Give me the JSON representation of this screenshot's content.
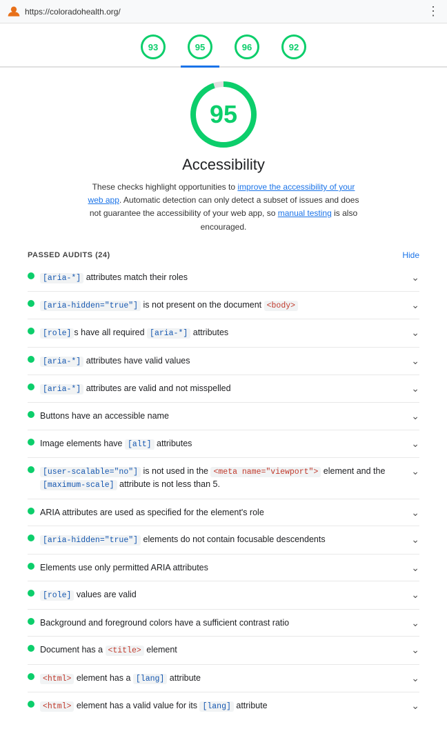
{
  "topbar": {
    "url": "https://coloradohealth.org/",
    "menu_label": "⋮"
  },
  "tabs": [
    {
      "id": "performance",
      "score": "93",
      "active": false
    },
    {
      "id": "accessibility",
      "score": "95",
      "active": true
    },
    {
      "id": "best-practices",
      "score": "96",
      "active": false
    },
    {
      "id": "seo",
      "score": "92",
      "active": false
    }
  ],
  "main_score": {
    "value": "95",
    "title": "Accessibility",
    "description_text": "These checks highlight opportunities to ",
    "link1_text": "improve the accessibility of your web app",
    "link1_href": "#",
    "mid_text": ". Automatic detection can only detect a subset of issues and does not guarantee the accessibility of your web app, so ",
    "link2_text": "manual testing",
    "link2_href": "#",
    "end_text": " is also encouraged."
  },
  "audit_section": {
    "header": "PASSED AUDITS (24)",
    "hide_label": "Hide",
    "items": [
      {
        "text_html": "[aria-*] attributes match their roles"
      },
      {
        "text_html": "[aria-hidden=\"true\"] is not present on the document <body>"
      },
      {
        "text_html": "[role]s have all required [aria-*] attributes"
      },
      {
        "text_html": "[aria-*] attributes have valid values"
      },
      {
        "text_html": "[aria-*] attributes are valid and not misspelled"
      },
      {
        "text_html": "Buttons have an accessible name"
      },
      {
        "text_html": "Image elements have [alt] attributes"
      },
      {
        "text_html": "[user-scalable=\"no\"] is not used in the <meta name=\"viewport\"> element and the [maximum-scale] attribute is not less than 5."
      },
      {
        "text_html": "ARIA attributes are used as specified for the element's role"
      },
      {
        "text_html": "[aria-hidden=\"true\"] elements do not contain focusable descendents"
      },
      {
        "text_html": "Elements use only permitted ARIA attributes"
      },
      {
        "text_html": "[role] values are valid"
      },
      {
        "text_html": "Background and foreground colors have a sufficient contrast ratio"
      },
      {
        "text_html": "Document has a <title> element"
      },
      {
        "text_html": "<html> element has a [lang] attribute"
      },
      {
        "text_html": "<html> element has a valid value for its [lang] attribute"
      }
    ]
  },
  "colors": {
    "green": "#0cce6b",
    "blue": "#1a73e8",
    "code_bg": "#f1f3f4"
  }
}
